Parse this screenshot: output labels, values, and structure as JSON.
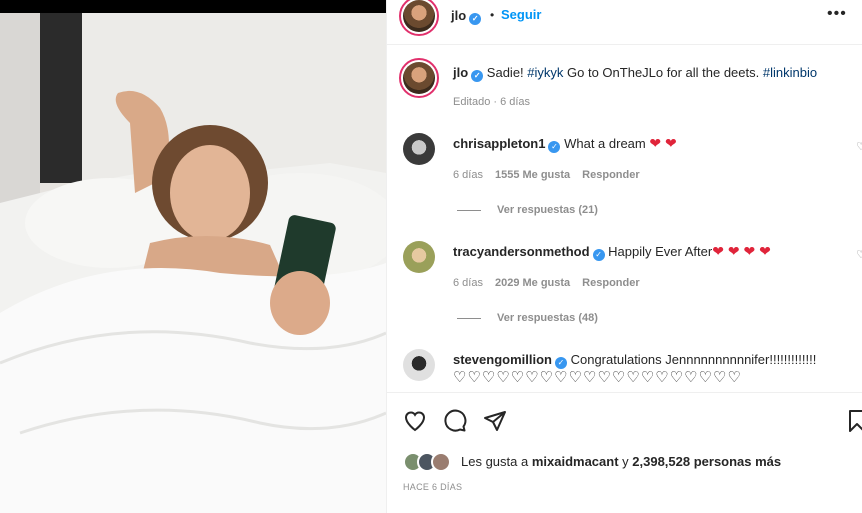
{
  "header": {
    "username": "jlo",
    "separator": "•",
    "follow_label": "Seguir",
    "more_label": "•••"
  },
  "caption": {
    "username": "jlo",
    "text_before": "Sadie! ",
    "tag1": "#iykyk",
    "text_middle": " Go to OnTheJLo for all the deets. ",
    "tag2": "#linkinbio",
    "meta": "Editado · 6 días"
  },
  "comments": [
    {
      "username": "chrisappleton1",
      "text": "What a dream",
      "hearts": "❤ ❤",
      "time": "6 días",
      "likes": "1555 Me gusta",
      "reply": "Responder",
      "view_replies": "Ver respuestas (21)"
    },
    {
      "username": "tracyandersonmethod",
      "text": "Happily Ever After",
      "hearts": "❤ ❤ ❤ ❤",
      "time": "6 días",
      "likes": "2029 Me gusta",
      "reply": "Responder",
      "view_replies": "Ver respuestas (48)"
    },
    {
      "username": "stevengomillion",
      "text": "Congratulations Jennnnnnnnnnifer!!!!!!!!!!!!!",
      "hearts": "♡♡♡♡♡♡♡♡♡♡♡♡♡♡♡♡♡♡♡♡"
    }
  ],
  "likes": {
    "prefix": "Les gusta a ",
    "user": "mixaidmacant",
    "middle": " y ",
    "count": "2,398,528 personas más"
  },
  "timestamp": "HACE 6 DÍAS",
  "icons": {
    "like": "heart-icon",
    "comment": "comment-icon",
    "share": "share-icon",
    "save": "bookmark-icon"
  },
  "colors": {
    "accent": "#0095f6",
    "verified": "#3897f0",
    "heart": "#e0243a",
    "muted": "#8e8e8e"
  }
}
